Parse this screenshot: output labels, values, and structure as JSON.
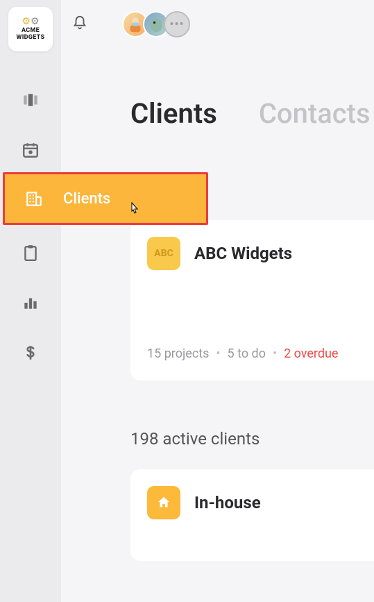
{
  "brand": {
    "name": "ACME WIDGETS"
  },
  "sidebar": {
    "active_label": "Clients"
  },
  "tabs": {
    "clients": "Clients",
    "contacts": "Contacts"
  },
  "pinned_client": {
    "badge": "ABC",
    "name": "ABC Widgets",
    "projects": "15 projects",
    "todo": "5 to do",
    "overdue": "2 overdue"
  },
  "clients_section": {
    "title": "198 active clients"
  },
  "client_rows": [
    {
      "name": "In-house"
    }
  ],
  "more_avatars": "•••"
}
